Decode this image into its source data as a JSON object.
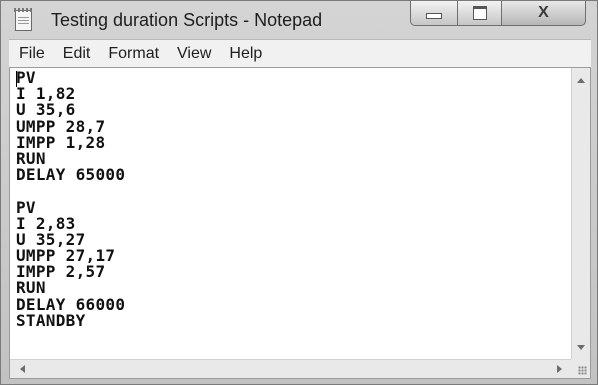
{
  "window": {
    "title": "Testing duration Scripts - Notepad",
    "icon": "notepad-icon"
  },
  "caption_buttons": {
    "minimize_icon": "minimize-icon",
    "maximize_icon": "maximize-icon",
    "close_glyph": "X"
  },
  "menu": {
    "items": [
      "File",
      "Edit",
      "Format",
      "View",
      "Help"
    ]
  },
  "editor": {
    "lines": [
      "PV",
      "I 1,82",
      "U 35,6",
      "UMPP 28,7",
      "IMPP 1,28",
      "RUN",
      "DELAY 65000",
      "",
      "PV",
      "I 2,83",
      "U 35,27",
      "UMPP 27,17",
      "IMPP 2,57",
      "RUN",
      "DELAY 66000",
      "STANDBY"
    ]
  }
}
